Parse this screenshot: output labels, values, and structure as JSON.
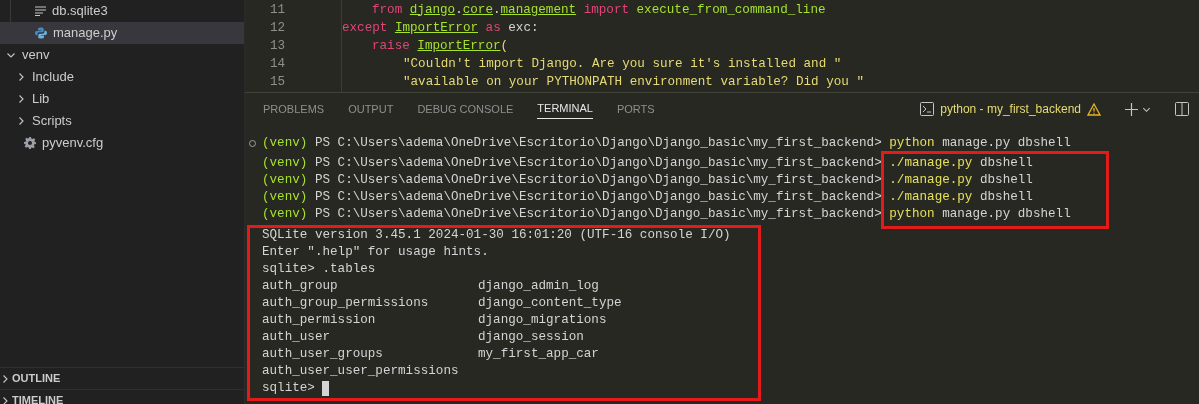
{
  "explorer": {
    "files_above": [
      {
        "label": "db.sqlite3",
        "kind": "text",
        "selected": false
      },
      {
        "label": "manage.py",
        "kind": "python",
        "selected": true
      }
    ],
    "tree": [
      {
        "label": "venv",
        "kind": "folder",
        "expanded": true,
        "selected": false,
        "children": [
          {
            "label": "Include",
            "kind": "folder",
            "expanded": false,
            "selected": false
          },
          {
            "label": "Lib",
            "kind": "folder",
            "expanded": false,
            "selected": false
          },
          {
            "label": "Scripts",
            "kind": "folder",
            "expanded": false,
            "selected": false
          },
          {
            "label": "pyvenv.cfg",
            "kind": "config",
            "selected": false
          }
        ]
      }
    ],
    "sections": [
      {
        "label": "OUTLINE",
        "expanded": false
      },
      {
        "label": "TIMELINE",
        "expanded": false
      }
    ]
  },
  "editor": {
    "lines": [
      {
        "number": "11",
        "kind": "block",
        "segments": [
          {
            "text": "from ",
            "kind": "keyword"
          },
          {
            "text": "django",
            "kind": "class"
          },
          {
            "text": ".",
            "kind": "plain"
          },
          {
            "text": "core",
            "kind": "class"
          },
          {
            "text": ".",
            "kind": "plain"
          },
          {
            "text": "management",
            "kind": "class"
          },
          {
            "text": " import ",
            "kind": "keyword"
          },
          {
            "text": "execute_from_command_line",
            "kind": "func"
          }
        ]
      },
      {
        "number": "12",
        "kind": "clause",
        "segments": [
          {
            "text": "except ",
            "kind": "keyword"
          },
          {
            "text": "ImportError",
            "kind": "class"
          },
          {
            "text": " as",
            "kind": "keyword"
          },
          {
            "text": " exc:",
            "kind": "plain"
          }
        ]
      },
      {
        "number": "13",
        "kind": "block",
        "segments": [
          {
            "text": "raise ",
            "kind": "keyword"
          },
          {
            "text": "ImportError",
            "kind": "class"
          },
          {
            "text": "(",
            "kind": "string"
          }
        ]
      },
      {
        "number": "14",
        "kind": "argument",
        "segments": [
          {
            "text": "\"Couldn't import Django. Are you sure it's installed and \"",
            "kind": "string"
          }
        ]
      },
      {
        "number": "15",
        "kind": "argument",
        "segments": [
          {
            "text": "\"available on your PYTHONPATH environment variable? Did you \"",
            "kind": "string"
          }
        ]
      }
    ]
  },
  "panel": {
    "tabs": [
      {
        "label": "PROBLEMS",
        "selected": false
      },
      {
        "label": "OUTPUT",
        "selected": false
      },
      {
        "label": "DEBUG CONSOLE",
        "selected": false
      },
      {
        "label": "TERMINAL",
        "selected": true
      },
      {
        "label": "PORTS",
        "selected": false
      }
    ],
    "terminal_name": "python - my_first_backend",
    "warning": true
  },
  "terminal": {
    "lines": [
      {
        "kind": "prompt",
        "dot": true,
        "segments": [
          {
            "text": "(venv)",
            "kind": "venv"
          },
          {
            "text": " PS C:\\Users\\adema\\OneDrive\\Escritorio\\Django\\Django_basic\\my_first_backend> ",
            "kind": "plain"
          },
          {
            "text": "python",
            "kind": "cmd"
          },
          {
            "text": " manage.py dbshell",
            "kind": "plain"
          }
        ]
      },
      {
        "kind": "prompt",
        "dot": false,
        "segments": [
          {
            "text": "(venv)",
            "kind": "venv"
          },
          {
            "text": " PS C:\\Users\\adema\\OneDrive\\Escritorio\\Django\\Django_basic\\my_first_backend> ",
            "kind": "plain"
          },
          {
            "text": "./manage.py",
            "kind": "cmd"
          },
          {
            "text": " dbshell",
            "kind": "plain"
          }
        ]
      },
      {
        "kind": "prompt",
        "dot": false,
        "segments": [
          {
            "text": "(venv)",
            "kind": "venv"
          },
          {
            "text": " PS C:\\Users\\adema\\OneDrive\\Escritorio\\Django\\Django_basic\\my_first_backend> ",
            "kind": "plain"
          },
          {
            "text": "./manage.py",
            "kind": "cmd"
          },
          {
            "text": " dbshell",
            "kind": "plain"
          }
        ]
      },
      {
        "kind": "prompt",
        "dot": false,
        "segments": [
          {
            "text": "(venv)",
            "kind": "venv"
          },
          {
            "text": " PS C:\\Users\\adema\\OneDrive\\Escritorio\\Django\\Django_basic\\my_first_backend> ",
            "kind": "plain"
          },
          {
            "text": "./manage.py",
            "kind": "cmd"
          },
          {
            "text": " dbshell",
            "kind": "plain"
          }
        ]
      },
      {
        "kind": "prompt",
        "dot": false,
        "segments": [
          {
            "text": "(venv)",
            "kind": "venv"
          },
          {
            "text": " PS C:\\Users\\adema\\OneDrive\\Escritorio\\Django\\Django_basic\\my_first_backend> ",
            "kind": "plain"
          },
          {
            "text": "python",
            "kind": "cmd"
          },
          {
            "text": " manage.py dbshell",
            "kind": "plain"
          }
        ]
      },
      {
        "kind": "output",
        "text": "SQLite version 3.45.1 2024-01-30 16:01:20 (UTF-16 console I/O)"
      },
      {
        "kind": "output",
        "text": "Enter \".help\" for usage hints."
      },
      {
        "kind": "output",
        "text": "sqlite> .tables"
      },
      {
        "kind": "table",
        "columns": [
          "auth_group",
          "django_admin_log"
        ]
      },
      {
        "kind": "table",
        "columns": [
          "auth_group_permissions",
          "django_content_type"
        ]
      },
      {
        "kind": "table",
        "columns": [
          "auth_permission",
          "django_migrations"
        ]
      },
      {
        "kind": "table",
        "columns": [
          "auth_user",
          "django_session"
        ]
      },
      {
        "kind": "table",
        "columns": [
          "auth_user_groups",
          "my_first_app_car"
        ]
      },
      {
        "kind": "table",
        "columns": [
          "auth_user_user_permissions"
        ]
      },
      {
        "kind": "output",
        "text": "sqlite> ",
        "cursor": true
      }
    ]
  }
}
